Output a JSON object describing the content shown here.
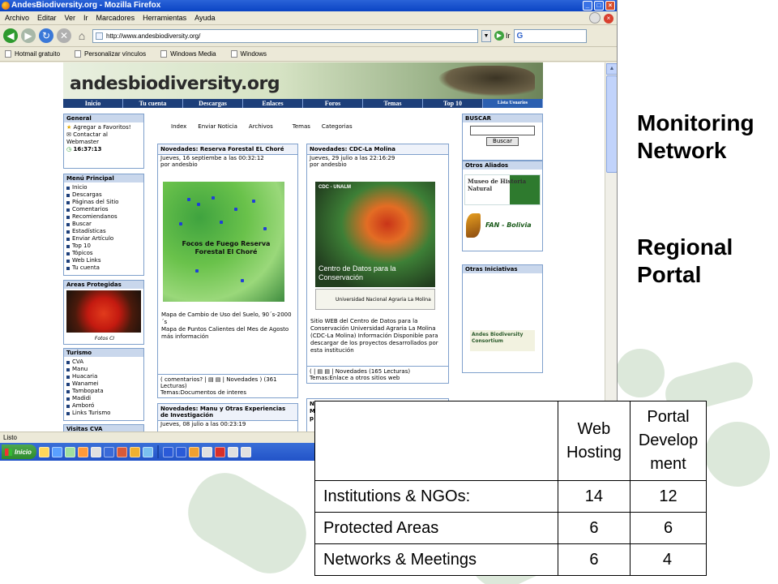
{
  "slide": {
    "heading_1": "Monitoring Network",
    "heading_1_lines": [
      "Monitoring",
      "Network"
    ],
    "heading_2_lines": [
      "Regional",
      "Portal"
    ]
  },
  "browser": {
    "title": "AndesBiodiversity.org - Mozilla Firefox",
    "menu": [
      "Archivo",
      "Editar",
      "Ver",
      "Ir",
      "Marcadores",
      "Herramientas",
      "Ayuda"
    ],
    "url": "http://www.andesbiodiversity.org/",
    "go_label": "Ir",
    "search_value": "G",
    "bookmarks": [
      "Hotmail gratuito",
      "Personalizar vínculos",
      "Windows Media",
      "Windows"
    ],
    "status": "Listo",
    "start_label": "Inicio"
  },
  "site": {
    "logo": "andesbiodiversity.org",
    "nav": [
      "Inicio",
      "Tu cuenta",
      "Descargas",
      "Enlaces",
      "Foros",
      "Temas",
      "Top 10",
      "Lista Usuarios"
    ],
    "center_links": [
      "Index",
      "Enviar Noticia",
      "Archivos",
      "Temas",
      "Categorias"
    ],
    "general": {
      "title": "General",
      "favorites": "Agregar a Favoritos!",
      "contact": "Contactar al Webmaster",
      "time": "16:37:13"
    },
    "menu_principal": {
      "title": "Menú Principal",
      "items": [
        "Inicio",
        "Descargas",
        "Páginas del Sitio",
        "Comentarios",
        "Recomiendanos",
        "Buscar",
        "Estadísticas",
        "Enviar Artículo",
        "Top 10",
        "Tópicos",
        "Web Links",
        "Tu cuenta"
      ]
    },
    "areas": {
      "title": "Areas Protegidas",
      "caption": "Fotos CI"
    },
    "turismo": {
      "title": "Turismo",
      "items": [
        "CVA",
        "Manu",
        "Huacaria",
        "Wanamei",
        "Tambopata",
        "Madidi",
        "Amboró",
        "Links Turismo"
      ]
    },
    "visitas": {
      "title": "Visitas CVA"
    },
    "news1": {
      "title": "Novedades: Reserva Forestal EL Choré",
      "date": "Jueves, 16 septiembe a las 00:32:12",
      "by": "por andesbio",
      "map_label": "Focos de Fuego Reserva Forestal El Choré",
      "body": [
        "Mapa de Cambio de Uso del Suelo, 90´s-2000´s",
        "Mapa de Puntos Calientes del Mes de Agosto",
        "más información"
      ],
      "foot": [
        "( comentarios? | ▤ ▤ | Novedades ) (361 Lecturas)",
        "Temas:Documentos de interes"
      ]
    },
    "news2": {
      "title": "Novedades: CDC-La Molina",
      "date": "Jueves, 29 julio a las 22:16:29",
      "by": "por andesbio",
      "image_text_small": "CDC - UNALM",
      "image_text": "Centro de Datos para la Conservación",
      "univ": "Universidad Nacional Agraria La Molina",
      "body": "Sitio WEB del Centro de Datos para la Conservación Universidad Agraria La Molina (CDC-La Molina) Información Disponible para descargar de los proyectos desarrollados por esta institución",
      "foot": [
        "( | ▤ ▤ | Novedades (165 Lecturas)",
        "Temas:Enlace a otros sitios web"
      ]
    },
    "news3": {
      "title": "Novedades: Manu y Otras Experiencias de Investigación",
      "date": "Jueves, 08 julio a las 00:23:19"
    },
    "news4": {
      "lines": [
        "N",
        "M",
        "p"
      ]
    },
    "buscar": {
      "title": "BUSCAR",
      "button": "Buscar"
    },
    "aliados": {
      "title": "Otros Aliados",
      "logo1": "Museo de Historia Natural",
      "logo2": "FAN - Bolivia"
    },
    "iniciativas": {
      "title": "Otras Iniciativas",
      "logo": "Andes Biodiversity Consortium"
    }
  },
  "table": {
    "headers": [
      "",
      "Web Hosting",
      "Portal Development"
    ],
    "header_lines": [
      [
        "Web",
        "Hosting"
      ],
      [
        "Portal",
        "Develop",
        "ment"
      ]
    ],
    "rows": [
      {
        "label": "Institutions & NGOs:",
        "web": "14",
        "portal": "12"
      },
      {
        "label": "Protected Areas",
        "web": "6",
        "portal": "6"
      },
      {
        "label": "Networks & Meetings",
        "web": "6",
        "portal": "4"
      }
    ]
  }
}
